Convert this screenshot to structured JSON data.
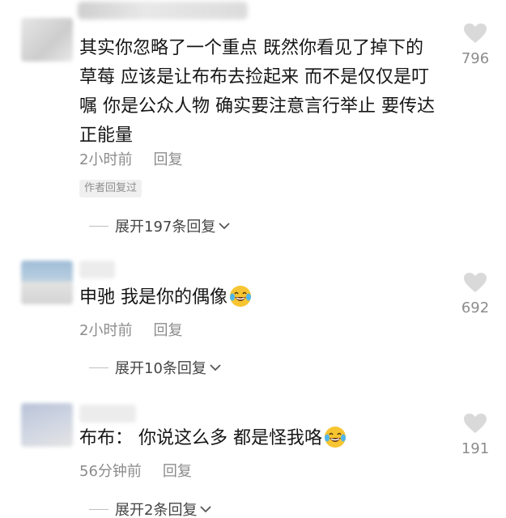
{
  "comments": [
    {
      "username": "",
      "text": "其实你忽略了一个重点 既然你看见了掉下的草莓 应该是让布布去捡起来 而不是仅仅是叮嘱 你是公众人物 确实要注意言行举止 要传达正能量",
      "time": "2小时前",
      "reply": "回复",
      "badge": "作者回复过",
      "expand": "展开197条回复",
      "likes": "796"
    },
    {
      "username": "",
      "text": "申驰 我是你的偶像",
      "emoji": "crying-laughing-emoji",
      "time": "2小时前",
      "reply": "回复",
      "expand": "展开10条回复",
      "likes": "692"
    },
    {
      "username": "",
      "text": "布布： 你说这么多 都是怪我咯",
      "emoji": "crying-laughing-emoji",
      "time": "56分钟前",
      "reply": "回复",
      "expand": "展开2条回复",
      "likes": "191"
    }
  ],
  "icons": {
    "like": "heart-icon",
    "expand": "chevron-down-icon"
  },
  "colors": {
    "text": "#161616",
    "meta": "#8c8c8c",
    "heart": "#d9d9d9",
    "emoji": "#f7c531"
  }
}
